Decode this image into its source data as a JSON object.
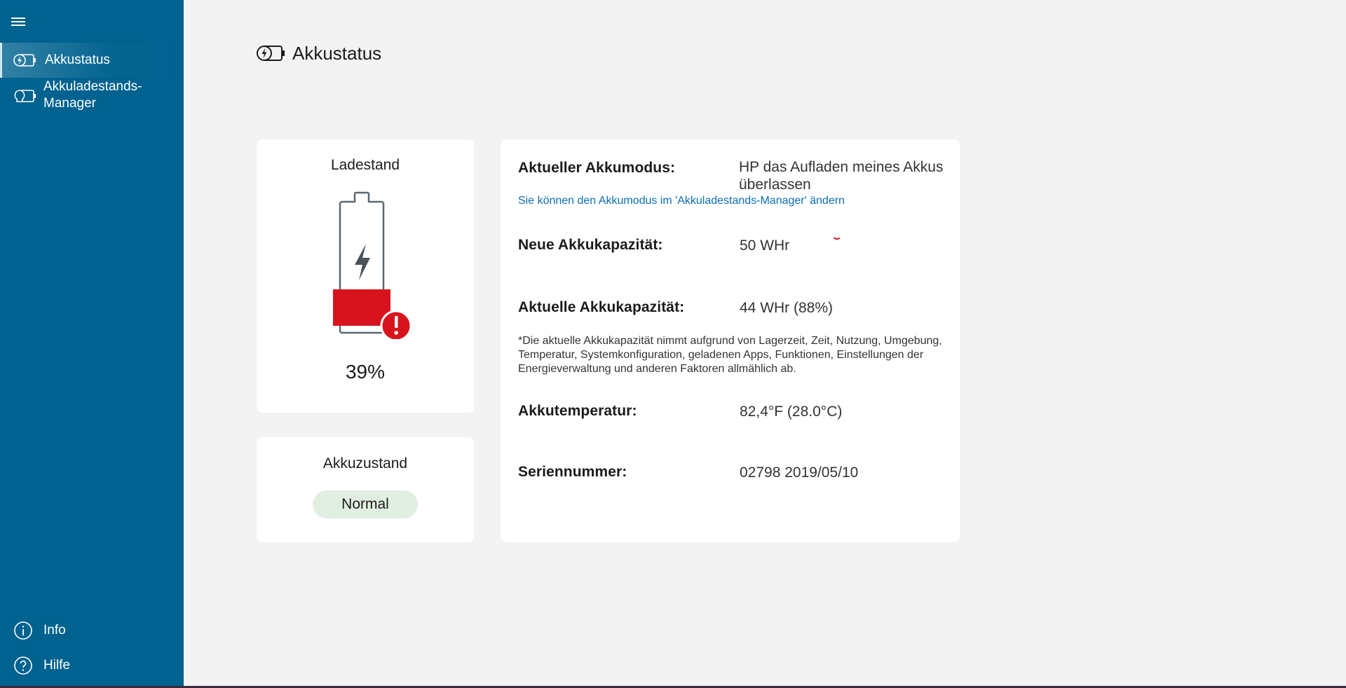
{
  "sidebar": {
    "menu_label": "Menu",
    "items": [
      {
        "label": "Akkustatus",
        "icon": "battery-bolt-icon",
        "active": true
      },
      {
        "label": "Akkuladestands-\nManager",
        "icon": "battery-bulb-icon",
        "active": false
      }
    ],
    "bottom": [
      {
        "label": "Info",
        "icon": "info-icon"
      },
      {
        "label": "Hilfe",
        "icon": "help-icon"
      }
    ],
    "color": "#00628f"
  },
  "page": {
    "title": "Akkustatus",
    "title_icon": "battery-bolt-icon"
  },
  "charge": {
    "heading": "Ladestand",
    "percent": "39%",
    "level": 0.39,
    "warning_icon": "exclamation-icon",
    "fill_color": "#d7141d"
  },
  "state": {
    "heading": "Akkuzustand",
    "status": "Normal"
  },
  "info": {
    "mode_label": "Aktueller Akkumodus:",
    "mode_value": "HP das Aufladen meines Akkus überlassen",
    "mode_link": "Sie können den Akkumodus im 'Akkuladestands-Manager' ändern",
    "new_capacity_label": "Neue Akkukapazität:",
    "new_capacity_value": "50 WHr",
    "current_capacity_label": "Aktuelle Akkukapazität:",
    "current_capacity_value": "44 WHr (88%)",
    "note": "*Die aktuelle Akkukapazität nimmt aufgrund von Lagerzeit, Zeit, Nutzung, Umgebung, Temperatur, Systemkonfiguration, geladenen Apps, Funktionen, Einstellungen der Energieverwaltung und anderen Faktoren allmählich ab.",
    "temperature_label": "Akkutemperatur:",
    "temperature_value": "82,4°F (28.0°C)",
    "serial_label": "Seriennummer:",
    "serial_value": "02798 2019/05/10"
  }
}
